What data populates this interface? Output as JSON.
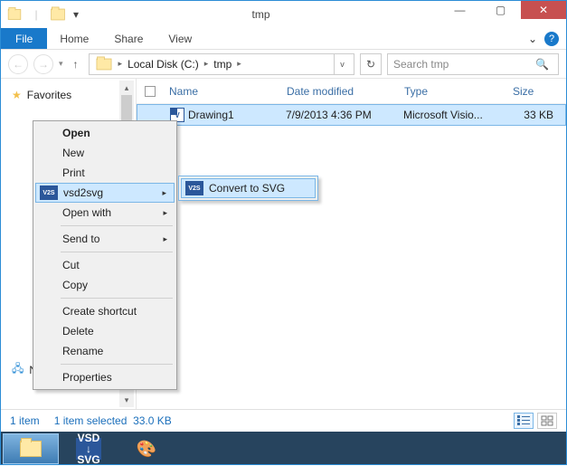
{
  "window": {
    "title": "tmp"
  },
  "toolbar": {
    "minimize_glyph": "—",
    "maximize_glyph": "▢",
    "close_glyph": "✕",
    "qat_dropdown_glyph": "▾"
  },
  "tabs": {
    "file": "File",
    "home": "Home",
    "share": "Share",
    "view": "View",
    "expand_glyph": "⌄",
    "help_glyph": "?"
  },
  "nav": {
    "back_glyph": "←",
    "forward_glyph": "→",
    "history_glyph": "▾",
    "up_glyph": "↑",
    "refresh_glyph": "↻",
    "dropdown_glyph": "v"
  },
  "breadcrumbs": {
    "items": [
      "Local Disk (C:)",
      "tmp"
    ],
    "sep_glyph": "▸",
    "root_glyph": "▸"
  },
  "search": {
    "placeholder": "Search tmp",
    "icon_glyph": "🔍"
  },
  "navpane": {
    "favorites": "Favorites",
    "network": "Network",
    "star_glyph": "★",
    "scroll_up": "▴",
    "scroll_down": "▾"
  },
  "columns": {
    "name": "Name",
    "date": "Date modified",
    "type": "Type",
    "size": "Size"
  },
  "files": [
    {
      "name": "Drawing1",
      "date": "7/9/2013 4:36 PM",
      "type": "Microsoft Visio...",
      "size": "33 KB"
    }
  ],
  "contextmenu": {
    "open": "Open",
    "new": "New",
    "print": "Print",
    "vsd2svg": "vsd2svg",
    "vsd2svg_icon": "V2S",
    "openwith": "Open with",
    "sendto": "Send to",
    "cut": "Cut",
    "copy": "Copy",
    "shortcut": "Create shortcut",
    "delete": "Delete",
    "rename": "Rename",
    "properties": "Properties",
    "arrow_glyph": "▸"
  },
  "submenu": {
    "convert": "Convert to SVG",
    "icon": "V2S"
  },
  "status": {
    "count": "1 item",
    "selection": "1 item selected",
    "size": "33.0 KB"
  },
  "taskbar": {
    "vsd_line1": "VSD",
    "vsd_down": "↓",
    "vsd_line2": "SVG",
    "paint_glyph": "🎨"
  }
}
